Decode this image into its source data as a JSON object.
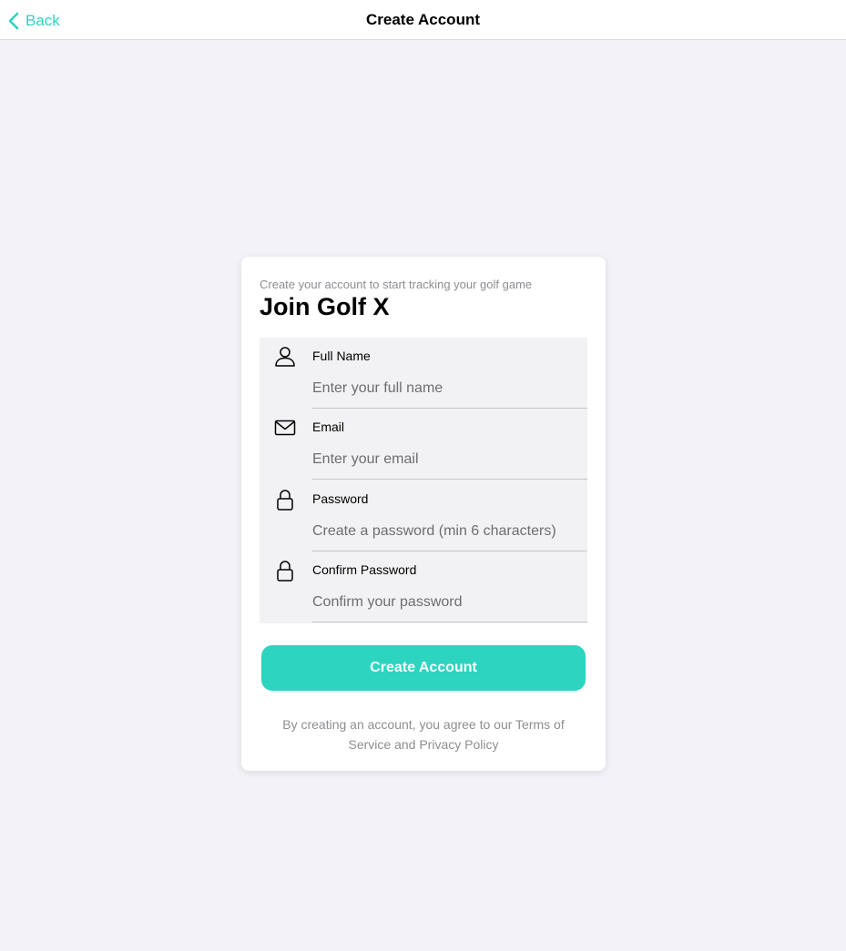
{
  "nav": {
    "back_label": "Back",
    "title": "Create Account"
  },
  "card": {
    "subtitle": "Create your account to start tracking your golf game",
    "heading": "Join Golf X",
    "fields": [
      {
        "label": "Full Name",
        "placeholder": "Enter your full name",
        "value": "",
        "icon": "person-icon"
      },
      {
        "label": "Email",
        "placeholder": "Enter your email",
        "value": "",
        "icon": "envelope-icon"
      },
      {
        "label": "Password",
        "placeholder": "Create a password (min 6 characters)",
        "value": "",
        "icon": "lock-icon"
      },
      {
        "label": "Confirm Password",
        "placeholder": "Confirm your password",
        "value": "",
        "icon": "lock-icon"
      }
    ],
    "submit_label": "Create Account",
    "legal": {
      "prefix": "By creating an account, you agree to our ",
      "terms_link": "Terms of Service",
      "and_text": " and ",
      "privacy_link": "Privacy Policy"
    }
  },
  "colors": {
    "accent": "#2dd4bf",
    "background": "#f2f2f7",
    "card": "#ffffff",
    "muted_text": "#8e8e93"
  }
}
